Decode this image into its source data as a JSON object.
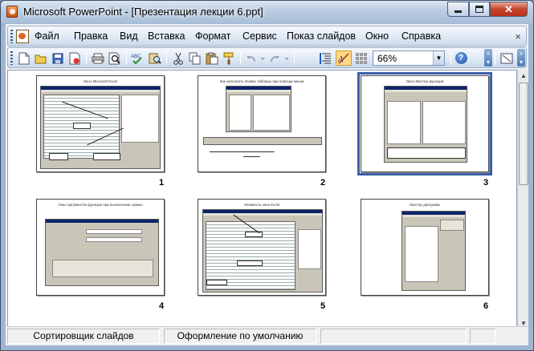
{
  "window": {
    "title": "Microsoft PowerPoint - [Презентация лекции 6.ppt]",
    "close_glyph": "✕",
    "accent": "#3b5fa7"
  },
  "menu": {
    "items": [
      "Файл",
      "Правка",
      "Вид",
      "Вставка",
      "Формат",
      "Сервис",
      "Показ слайдов",
      "Окно",
      "Справка"
    ],
    "close_glyph": "×"
  },
  "toolbar": {
    "buttons": [
      "new-icon",
      "open-icon",
      "save-icon",
      "permission-icon",
      "print-icon",
      "print-preview-icon",
      "spelling-icon",
      "research-icon",
      "cut-icon",
      "copy-icon",
      "paste-icon",
      "format-painter-icon",
      "undo-icon",
      "redo-icon",
      "expand-all-icon",
      "show-formatting-icon",
      "grayscale-icon"
    ],
    "zoom": "66%",
    "help_glyph": "?"
  },
  "slides": [
    {
      "number": "1",
      "title": "Окно Microsoft Excel"
    },
    {
      "number": "2",
      "title": "Как заполнить ячейки таблицы при помощи мыши"
    },
    {
      "number": "3",
      "title": "Окно Мастер функций",
      "selected": true
    },
    {
      "number": "4",
      "title": "Окно аргументов функции при вычислении суммы"
    },
    {
      "number": "5",
      "title": "Элементы окна Excel"
    },
    {
      "number": "6",
      "title": "Мастер диаграмм"
    }
  ],
  "status": {
    "view": "Сортировщик слайдов",
    "design": "Оформление по умолчанию"
  }
}
